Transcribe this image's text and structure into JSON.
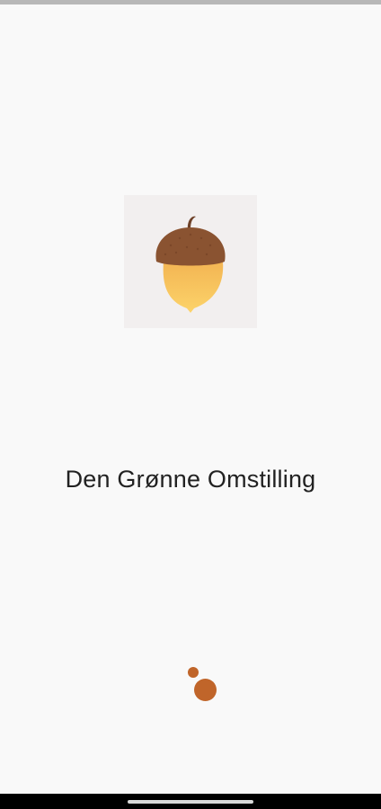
{
  "app": {
    "title": "Den Grønne Omstilling"
  },
  "logo": {
    "icon": "acorn-icon",
    "cap_color": "#8a5331",
    "body_color_top": "#f3b553",
    "body_color_bottom": "#fcd36a",
    "tile_color": "#f2efef"
  },
  "loader": {
    "icon": "loading-dots-icon",
    "color": "#c0652a"
  },
  "colors": {
    "background": "#f9f9f9",
    "text": "#222222"
  }
}
